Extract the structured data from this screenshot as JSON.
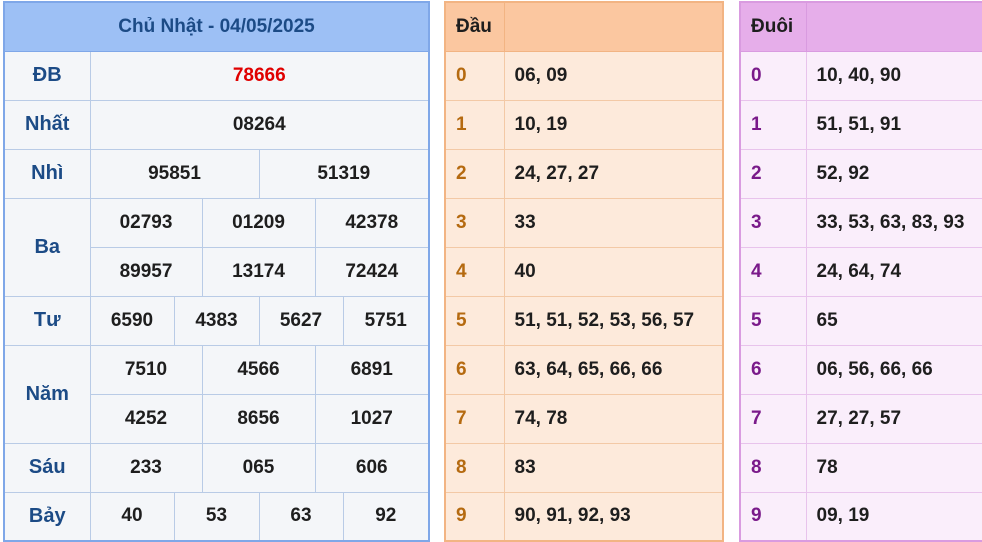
{
  "results": {
    "title": "Chủ Nhật - 04/05/2025",
    "db": {
      "label": "ĐB",
      "value": "78666"
    },
    "nhat": {
      "label": "Nhất",
      "value": "08264"
    },
    "nhi": {
      "label": "Nhì",
      "values": [
        "95851",
        "51319"
      ]
    },
    "ba": {
      "label": "Ba",
      "values": [
        "02793",
        "01209",
        "42378",
        "89957",
        "13174",
        "72424"
      ]
    },
    "tu": {
      "label": "Tư",
      "values": [
        "6590",
        "4383",
        "5627",
        "5751"
      ]
    },
    "nam": {
      "label": "Năm",
      "values": [
        "7510",
        "4566",
        "6891",
        "4252",
        "8656",
        "1027"
      ]
    },
    "sau": {
      "label": "Sáu",
      "values": [
        "233",
        "065",
        "606"
      ]
    },
    "bay": {
      "label": "Bảy",
      "values": [
        "40",
        "53",
        "63",
        "92"
      ]
    }
  },
  "dau": {
    "header": "Đầu",
    "rows": [
      {
        "digit": "0",
        "values": "06, 09"
      },
      {
        "digit": "1",
        "values": "10, 19"
      },
      {
        "digit": "2",
        "values": "24, 27, 27"
      },
      {
        "digit": "3",
        "values": "33"
      },
      {
        "digit": "4",
        "values": "40"
      },
      {
        "digit": "5",
        "values": "51, 51, 52, 53, 56, 57"
      },
      {
        "digit": "6",
        "values": "63, 64, 65, 66, 66"
      },
      {
        "digit": "7",
        "values": "74, 78"
      },
      {
        "digit": "8",
        "values": "83"
      },
      {
        "digit": "9",
        "values": "90, 91, 92, 93"
      }
    ]
  },
  "duoi": {
    "header": "Đuôi",
    "rows": [
      {
        "digit": "0",
        "values": "10, 40, 90"
      },
      {
        "digit": "1",
        "values": "51, 51, 91"
      },
      {
        "digit": "2",
        "values": "52, 92"
      },
      {
        "digit": "3",
        "values": "33, 53, 63, 83, 93"
      },
      {
        "digit": "4",
        "values": "24, 64, 74"
      },
      {
        "digit": "5",
        "values": "65"
      },
      {
        "digit": "6",
        "values": "06, 56, 66, 66"
      },
      {
        "digit": "7",
        "values": "27, 27, 57"
      },
      {
        "digit": "8",
        "values": "78"
      },
      {
        "digit": "9",
        "values": "09, 19"
      }
    ]
  },
  "colors": {
    "special": "#e00000",
    "results_header": "#9dc0f5",
    "dau_header": "#fbc7a0",
    "duoi_header": "#e6aeea"
  }
}
